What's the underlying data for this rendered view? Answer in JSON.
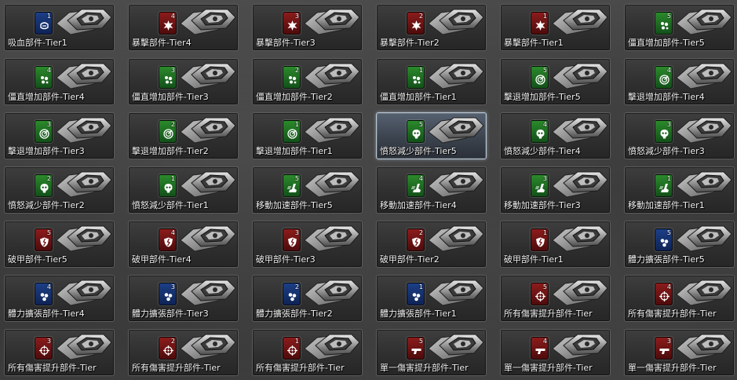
{
  "colors": {
    "blue": "#1c3f86",
    "red": "#8c1c1c",
    "green": "#2b8a2b",
    "selected_border": "#b9c6d2"
  },
  "items": [
    {
      "label": "吸血部件-Tier1",
      "tier": "1",
      "color": "blue",
      "icon": "lifesteal-icon"
    },
    {
      "label": "暴擊部件-Tier4",
      "tier": "4",
      "color": "red",
      "icon": "critical-icon"
    },
    {
      "label": "暴擊部件-Tier3",
      "tier": "3",
      "color": "red",
      "icon": "critical-icon"
    },
    {
      "label": "暴擊部件-Tier2",
      "tier": "2",
      "color": "red",
      "icon": "critical-icon"
    },
    {
      "label": "暴擊部件-Tier1",
      "tier": "1",
      "color": "red",
      "icon": "critical-icon"
    },
    {
      "label": "僵直增加部件-Tier5",
      "tier": "5",
      "color": "green",
      "icon": "stagger-icon"
    },
    {
      "label": "僵直增加部件-Tier4",
      "tier": "4",
      "color": "green",
      "icon": "stagger-icon"
    },
    {
      "label": "僵直增加部件-Tier3",
      "tier": "3",
      "color": "green",
      "icon": "stagger-icon"
    },
    {
      "label": "僵直增加部件-Tier2",
      "tier": "2",
      "color": "green",
      "icon": "stagger-icon"
    },
    {
      "label": "僵直增加部件-Tier1",
      "tier": "1",
      "color": "green",
      "icon": "stagger-icon"
    },
    {
      "label": "擊退增加部件-Tier5",
      "tier": "5",
      "color": "green",
      "icon": "knockback-icon"
    },
    {
      "label": "擊退增加部件-Tier4",
      "tier": "4",
      "color": "green",
      "icon": "knockback-icon"
    },
    {
      "label": "擊退增加部件-Tier3",
      "tier": "3",
      "color": "green",
      "icon": "knockback-icon"
    },
    {
      "label": "擊退增加部件-Tier2",
      "tier": "2",
      "color": "green",
      "icon": "knockback-icon"
    },
    {
      "label": "擊退增加部件-Tier1",
      "tier": "1",
      "color": "green",
      "icon": "knockback-icon"
    },
    {
      "label": "憤怒減少部件-Tier5",
      "tier": "5",
      "color": "green",
      "icon": "anger-reduce-icon",
      "selected": true
    },
    {
      "label": "憤怒減少部件-Tier4",
      "tier": "4",
      "color": "green",
      "icon": "anger-reduce-icon"
    },
    {
      "label": "憤怒減少部件-Tier3",
      "tier": "3",
      "color": "green",
      "icon": "anger-reduce-icon"
    },
    {
      "label": "憤怒減少部件-Tier2",
      "tier": "2",
      "color": "green",
      "icon": "anger-reduce-icon"
    },
    {
      "label": "憤怒減少部件-Tier1",
      "tier": "1",
      "color": "green",
      "icon": "anger-reduce-icon"
    },
    {
      "label": "移動加速部件-Tier5",
      "tier": "5",
      "color": "green",
      "icon": "speed-boot-icon"
    },
    {
      "label": "移動加速部件-Tier4",
      "tier": "4",
      "color": "green",
      "icon": "speed-boot-icon"
    },
    {
      "label": "移動加速部件-Tier3",
      "tier": "3",
      "color": "green",
      "icon": "speed-boot-icon"
    },
    {
      "label": "移動加速部件-Tier1",
      "tier": "1",
      "color": "green",
      "icon": "speed-boot-icon"
    },
    {
      "label": "破甲部件-Tier5",
      "tier": "5",
      "color": "red",
      "icon": "armor-break-icon"
    },
    {
      "label": "破甲部件-Tier4",
      "tier": "4",
      "color": "red",
      "icon": "armor-break-icon"
    },
    {
      "label": "破甲部件-Tier3",
      "tier": "3",
      "color": "red",
      "icon": "armor-break-icon"
    },
    {
      "label": "破甲部件-Tier2",
      "tier": "2",
      "color": "red",
      "icon": "armor-break-icon"
    },
    {
      "label": "破甲部件-Tier1",
      "tier": "1",
      "color": "red",
      "icon": "armor-break-icon"
    },
    {
      "label": "體力擴張部件-Tier5",
      "tier": "5",
      "color": "blue",
      "icon": "stamina-icon"
    },
    {
      "label": "體力擴張部件-Tier4",
      "tier": "4",
      "color": "blue",
      "icon": "stamina-icon"
    },
    {
      "label": "體力擴張部件-Tier3",
      "tier": "3",
      "color": "blue",
      "icon": "stamina-icon"
    },
    {
      "label": "體力擴張部件-Tier2",
      "tier": "2",
      "color": "blue",
      "icon": "stamina-icon"
    },
    {
      "label": "體力擴張部件-Tier1",
      "tier": "1",
      "color": "blue",
      "icon": "stamina-icon"
    },
    {
      "label": "所有傷害提升部件-Tier",
      "tier": "5",
      "color": "red",
      "icon": "crosshair-icon"
    },
    {
      "label": "所有傷害提升部件-Tier",
      "tier": "4",
      "color": "red",
      "icon": "crosshair-icon"
    },
    {
      "label": "所有傷害提升部件-Tier",
      "tier": "3",
      "color": "red",
      "icon": "crosshair-icon"
    },
    {
      "label": "所有傷害提升部件-Tier",
      "tier": "2",
      "color": "red",
      "icon": "crosshair-icon"
    },
    {
      "label": "所有傷害提升部件-Tier",
      "tier": "1",
      "color": "red",
      "icon": "crosshair-icon"
    },
    {
      "label": "單一傷害提升部件-Tier",
      "tier": "5",
      "color": "red",
      "icon": "gun-icon"
    },
    {
      "label": "單一傷害提升部件-Tier",
      "tier": "4",
      "color": "red",
      "icon": "gun-icon"
    },
    {
      "label": "單一傷害提升部件-Tier",
      "tier": "3",
      "color": "red",
      "icon": "gun-icon"
    }
  ]
}
